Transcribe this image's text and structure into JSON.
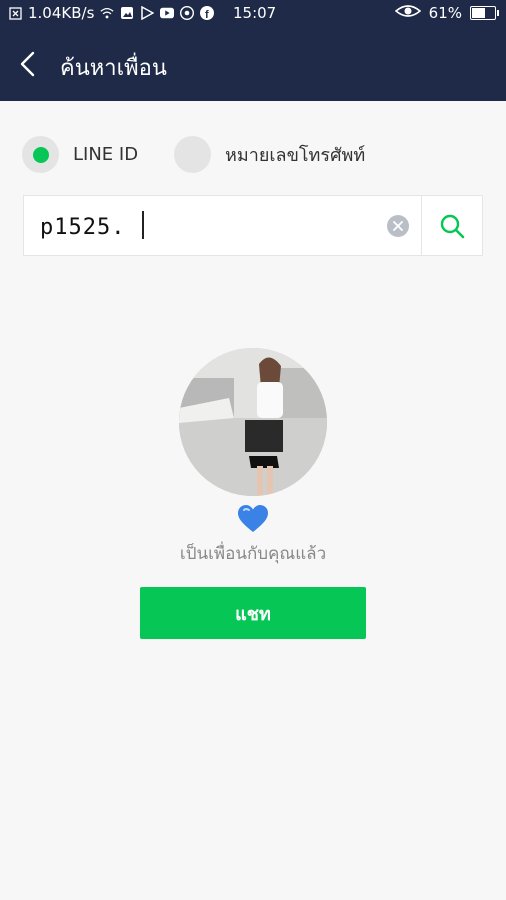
{
  "status_bar": {
    "network_speed": "1.04KB/s",
    "time": "15:07",
    "battery_percent": "61%",
    "battery_level": 0.61,
    "icons": [
      "close-box-icon",
      "wifi-icon",
      "gallery-icon",
      "play-store-icon",
      "youtube-icon",
      "chrome-icon",
      "facebook-icon",
      "eye-icon",
      "battery-icon"
    ]
  },
  "header": {
    "title": "ค้นหาเพื่อน",
    "back_icon": "chevron-left-icon"
  },
  "search_type": {
    "options": [
      {
        "label": "LINE ID",
        "selected": true
      },
      {
        "label": "หมายเลขโทรศัพท์",
        "selected": false
      }
    ]
  },
  "search": {
    "value": "p1525.",
    "clear_icon": "clear-icon",
    "search_icon": "search-icon"
  },
  "result": {
    "status": "เป็นเพื่อนกับคุณแล้ว",
    "heart_icon": "blue-heart-icon",
    "chat_label": "แชท"
  },
  "colors": {
    "header_bg": "#1e2a47",
    "accent_green": "#06c755",
    "background": "#f7f7f7"
  }
}
